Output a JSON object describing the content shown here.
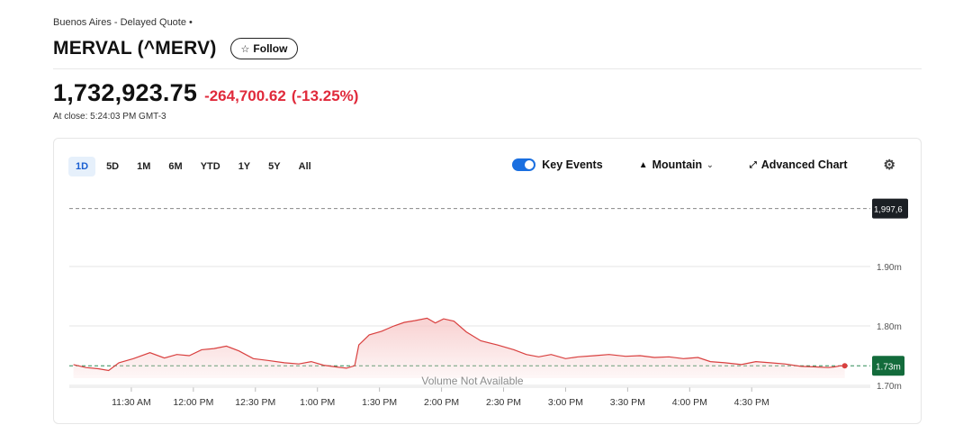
{
  "header": {
    "exchange": "Buenos Aires - Delayed Quote •",
    "title": "MERVAL (^MERV)",
    "follow_label": "Follow",
    "price": "1,732,923.75",
    "change": "-264,700.62",
    "change_pct": "(-13.25%)",
    "close_time": "At close: 5:24:03 PM GMT-3"
  },
  "toolbar": {
    "ranges": [
      "1D",
      "5D",
      "1M",
      "6M",
      "YTD",
      "1Y",
      "5Y",
      "All"
    ],
    "active_range": "1D",
    "key_events_label": "Key Events",
    "key_events_on": true,
    "chart_type_label": "Mountain",
    "advanced_label": "Advanced Chart",
    "icons": {
      "chart_type": "mountain-icon",
      "advanced": "expand-icon",
      "settings": "gear-icon"
    }
  },
  "colors": {
    "line": "#d9403f",
    "fill": "#f7c9c9",
    "last_badge": "#136b3b",
    "prev_badge": "#1b1f24",
    "accent": "#1a6fe0",
    "negative": "#e02a3b"
  },
  "chart_data": {
    "type": "area",
    "x_ticks": [
      "11:30 AM",
      "12:00 PM",
      "12:30 PM",
      "1:00 PM",
      "1:30 PM",
      "2:00 PM",
      "2:30 PM",
      "3:00 PM",
      "3:30 PM",
      "4:00 PM",
      "4:30 PM"
    ],
    "y_ticks": [
      "1.70m",
      "1.80m",
      "1.90m"
    ],
    "y_tick_values": [
      1700000,
      1800000,
      1900000
    ],
    "ylim": [
      1700000,
      2000000
    ],
    "prev_close_label": "1,997,6",
    "prev_close_value": 1997624,
    "last_label": "1.73m",
    "last_value": 1732924,
    "volume_note": "Volume Not Available",
    "grid": true,
    "series": [
      {
        "x": [
          "11:02",
          "11:08",
          "11:14",
          "11:19",
          "11:24",
          "11:31",
          "11:39",
          "11:46",
          "11:52",
          "11:58",
          "12:04",
          "12:10",
          "12:16",
          "12:22",
          "12:29",
          "12:36",
          "12:44",
          "12:51",
          "12:57",
          "13:03",
          "13:09",
          "13:14",
          "13:18",
          "13:20",
          "13:25",
          "13:31",
          "13:37",
          "13:42",
          "13:47",
          "13:53",
          "13:57",
          "14:01",
          "14:06",
          "14:12",
          "14:19",
          "14:27",
          "14:35",
          "14:41",
          "14:47",
          "14:53",
          "15:00",
          "15:06",
          "15:14",
          "15:21",
          "15:29",
          "15:36",
          "15:43",
          "15:50",
          "15:57",
          "16:04",
          "16:10",
          "16:17",
          "16:25",
          "16:32",
          "16:39",
          "16:46",
          "16:54",
          "17:01",
          "17:07",
          "17:10",
          "17:13",
          "17:15"
        ],
        "values": [
          1735000,
          1730000,
          1728000,
          1725000,
          1738000,
          1745000,
          1755000,
          1746000,
          1752000,
          1750000,
          1760000,
          1762000,
          1766000,
          1758000,
          1745000,
          1742000,
          1738000,
          1736000,
          1740000,
          1734000,
          1731000,
          1729000,
          1733000,
          1768000,
          1785000,
          1791000,
          1800000,
          1806000,
          1809000,
          1813000,
          1805000,
          1812000,
          1808000,
          1790000,
          1775000,
          1768000,
          1760000,
          1752000,
          1748000,
          1752000,
          1745000,
          1748000,
          1750000,
          1752000,
          1749000,
          1750000,
          1747000,
          1748000,
          1745000,
          1747000,
          1740000,
          1738000,
          1735000,
          1740000,
          1738000,
          1736000,
          1732000,
          1731000,
          1730000,
          1731000,
          1733000,
          1732924
        ]
      }
    ]
  }
}
